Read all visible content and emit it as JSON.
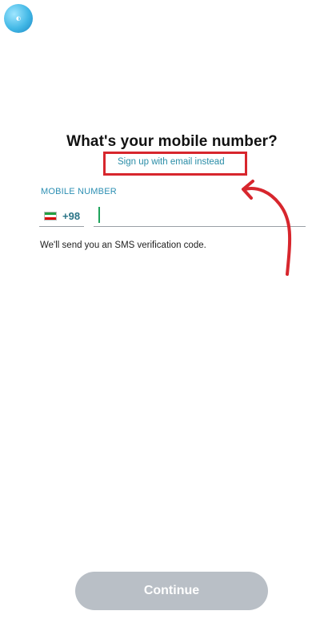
{
  "header": {
    "logo_icon": "watermark-logo"
  },
  "main": {
    "title": "What's your mobile number?",
    "email_link": "Sign up with email instead",
    "field_label": "MOBILE NUMBER",
    "country_code": "+98",
    "country_flag_icon": "iran-flag-icon",
    "phone_value": "",
    "helper_text": "We'll send you an SMS verification code."
  },
  "annotation": {
    "highlight_color": "#d7262d",
    "arrow_color": "#d7262d",
    "arrow_icon": "curved-arrow-icon"
  },
  "footer": {
    "continue_label": "Continue"
  }
}
